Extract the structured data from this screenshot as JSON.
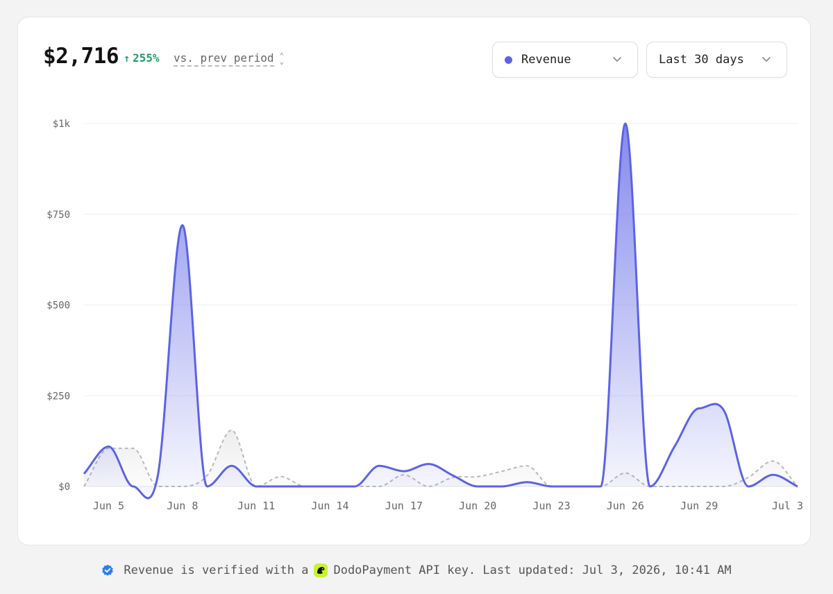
{
  "summary": {
    "total": "$2,716",
    "change": "255%",
    "compare_label": "vs. prev period"
  },
  "controls": {
    "metric_label": "Revenue",
    "range_label": "Last 30 days"
  },
  "colors": {
    "revenue": "#5b63e6",
    "previous": "#b8b8c0",
    "positive": "#1f9d6a",
    "verified": "#2f7ef5",
    "brand": "#c6f432"
  },
  "footer": {
    "text_before": "Revenue is verified with a",
    "text_after": "DodoPayment API key. Last updated: Jul 3, 2026, 10:41 AM"
  },
  "chart_data": {
    "type": "area",
    "x": [
      "Jun 4",
      "Jun 5",
      "Jun 6",
      "Jun 7",
      "Jun 8",
      "Jun 9",
      "Jun 10",
      "Jun 11",
      "Jun 12",
      "Jun 13",
      "Jun 14",
      "Jun 15",
      "Jun 16",
      "Jun 17",
      "Jun 18",
      "Jun 19",
      "Jun 20",
      "Jun 21",
      "Jun 22",
      "Jun 23",
      "Jun 24",
      "Jun 25",
      "Jun 26",
      "Jun 27",
      "Jun 28",
      "Jun 29",
      "Jun 30",
      "Jul 1",
      "Jul 2",
      "Jul 3"
    ],
    "x_ticks": [
      "Jun 5",
      "Jun 8",
      "Jun 11",
      "Jun 14",
      "Jun 17",
      "Jun 20",
      "Jun 23",
      "Jun 26",
      "Jun 29",
      "Jul 3"
    ],
    "series": [
      {
        "name": "Revenue",
        "values": [
          35,
          110,
          0,
          30,
          720,
          0,
          57,
          0,
          0,
          0,
          0,
          0,
          57,
          42,
          62,
          30,
          0,
          0,
          12,
          0,
          0,
          0,
          1000,
          0,
          110,
          215,
          210,
          0,
          32,
          0
        ]
      },
      {
        "values": [
          0,
          105,
          105,
          0,
          0,
          30,
          155,
          0,
          27,
          0,
          0,
          0,
          0,
          32,
          0,
          25,
          27,
          42,
          57,
          0,
          0,
          0,
          37,
          0,
          0,
          0,
          0,
          25,
          70,
          0
        ]
      }
    ],
    "y_ticks": [
      {
        "value": 0,
        "label": "$0"
      },
      {
        "value": 250,
        "label": "$250"
      },
      {
        "value": 500,
        "label": "$500"
      },
      {
        "value": 750,
        "label": "$750"
      },
      {
        "value": 1000,
        "label": "$1k"
      }
    ],
    "ylim": [
      0,
      1000
    ],
    "grid": true
  }
}
